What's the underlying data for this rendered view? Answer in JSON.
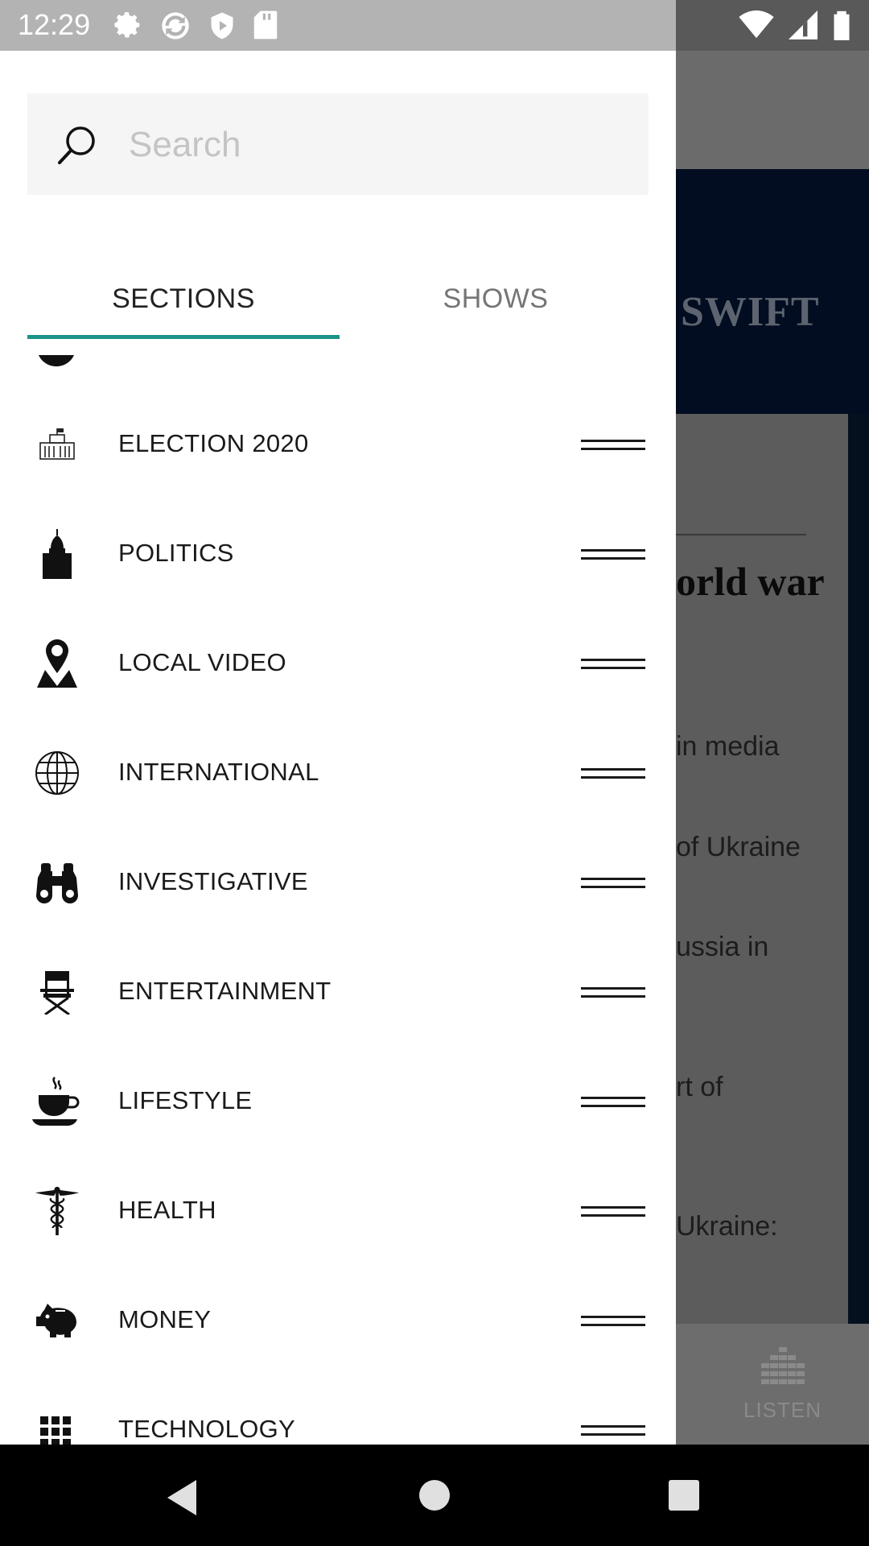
{
  "status_bar": {
    "time": "12:29",
    "left_icons": [
      "gear-icon",
      "sync-icon",
      "play-shield-icon",
      "sd-card-icon"
    ],
    "right_icons": [
      "wifi-icon",
      "cell-signal-icon",
      "battery-icon"
    ]
  },
  "search": {
    "placeholder": "Search",
    "value": ""
  },
  "tabs": [
    {
      "label": "SECTIONS",
      "selected": true
    },
    {
      "label": "SHOWS",
      "selected": false
    }
  ],
  "accent_color": "#1b9388",
  "sections": [
    {
      "label": "ELECTION 2020",
      "icon": "capitol-building-icon"
    },
    {
      "label": "POLITICS",
      "icon": "dome-icon"
    },
    {
      "label": "LOCAL VIDEO",
      "icon": "map-pin-icon"
    },
    {
      "label": "INTERNATIONAL",
      "icon": "globe-icon"
    },
    {
      "label": "INVESTIGATIVE",
      "icon": "binoculars-icon"
    },
    {
      "label": "ENTERTAINMENT",
      "icon": "directors-chair-icon"
    },
    {
      "label": "LIFESTYLE",
      "icon": "coffee-cup-icon"
    },
    {
      "label": "HEALTH",
      "icon": "caduceus-icon"
    },
    {
      "label": "MONEY",
      "icon": "piggy-bank-icon"
    },
    {
      "label": "TECHNOLOGY",
      "icon": "grid-icon"
    }
  ],
  "background_app": {
    "banner_text": "SWIFT",
    "headline": "orld war",
    "lines": [
      "in media",
      "of Ukraine",
      "ussia in",
      "rt of",
      "Ukraine:"
    ],
    "bottom_tab_label": "LISTEN"
  }
}
